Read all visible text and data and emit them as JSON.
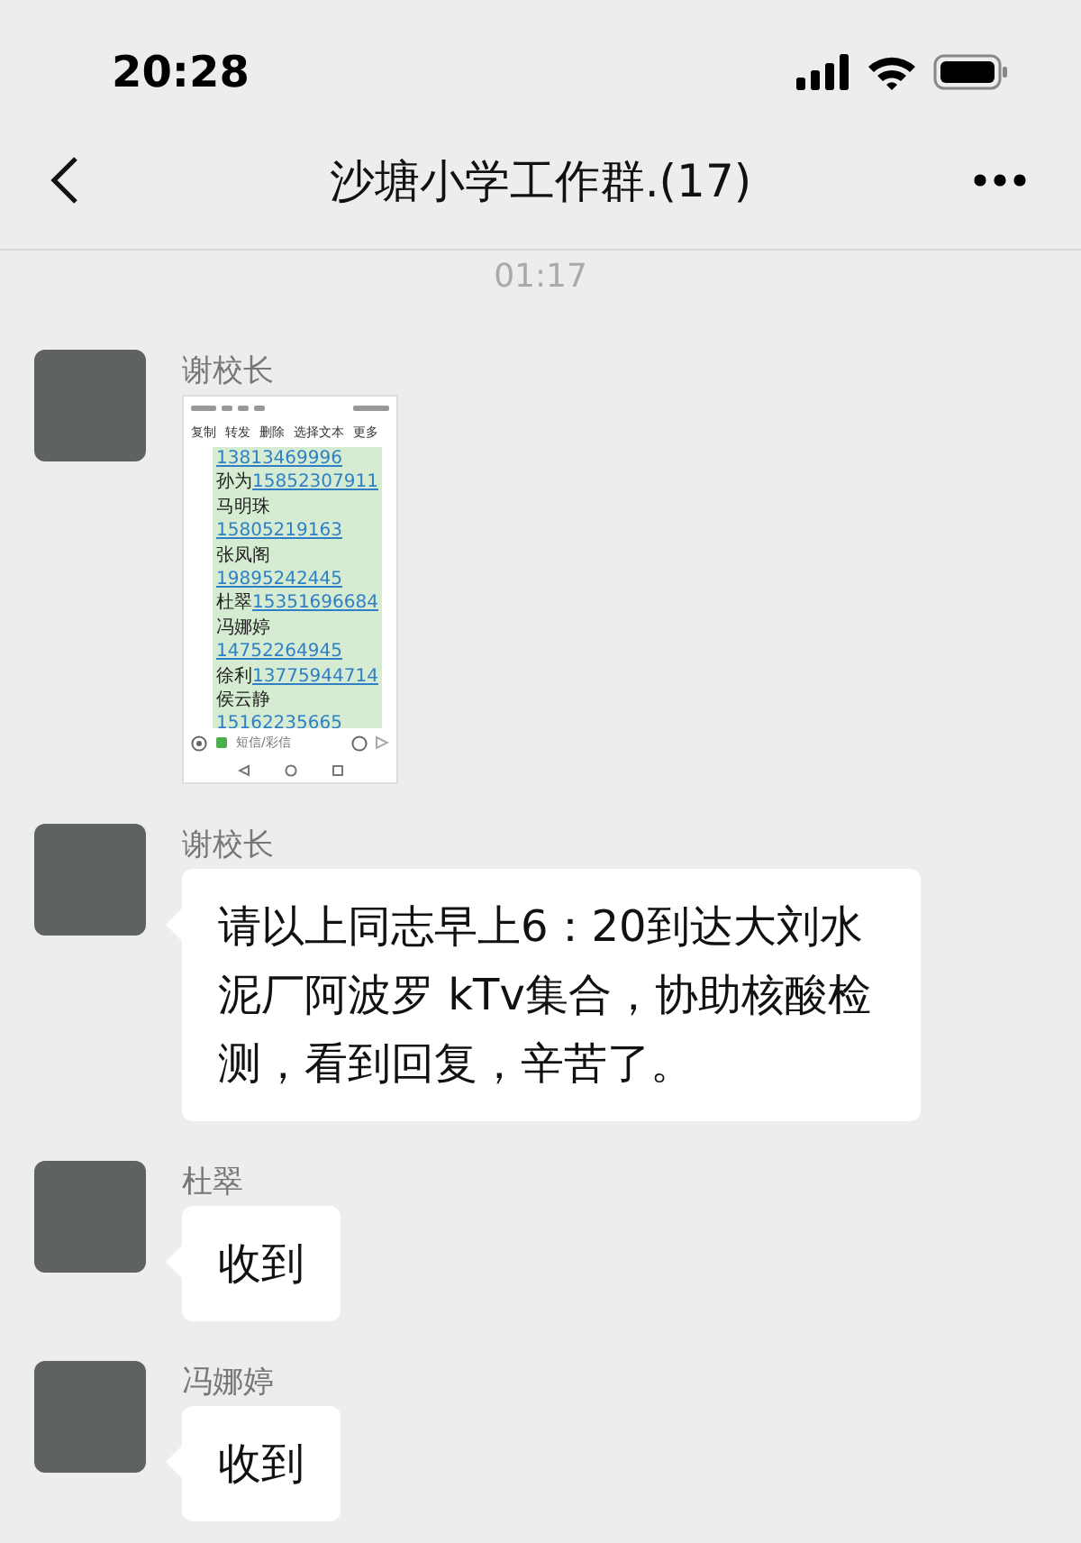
{
  "status_bar": {
    "time": "20:28"
  },
  "nav": {
    "title": "沙塘小学工作群.(17)"
  },
  "timestamp": "01:17",
  "messages": [
    {
      "kind": "image",
      "sender": "谢校长",
      "image": {
        "toolbar": [
          "复制",
          "转发",
          "删除",
          "选择文本",
          "更多"
        ],
        "lines": [
          {
            "phone": "13813469996"
          },
          {
            "name": "孙为",
            "phone": "15852307911"
          },
          {
            "name": "马明珠"
          },
          {
            "phone": "15805219163"
          },
          {
            "name": "张凤阁"
          },
          {
            "phone": "19895242445"
          },
          {
            "name": "杜翠",
            "phone": "15351696684"
          },
          {
            "name": "冯娜婷"
          },
          {
            "phone": "14752264945"
          },
          {
            "name": "徐利",
            "phone": "13775944714"
          },
          {
            "name": "侯云静"
          },
          {
            "phone": "15162235665"
          }
        ],
        "input_placeholder": "短信/彩信"
      }
    },
    {
      "kind": "text",
      "sender": "谢校长",
      "text": "请以上同志早上6：20到达大刘水泥厂阿波罗 kTv集合，协助核酸检测，看到回复，辛苦了。"
    },
    {
      "kind": "text",
      "sender": "杜翠",
      "text": "收到"
    },
    {
      "kind": "text",
      "sender": "冯娜婷",
      "text": "收到"
    },
    {
      "kind": "cut"
    }
  ]
}
